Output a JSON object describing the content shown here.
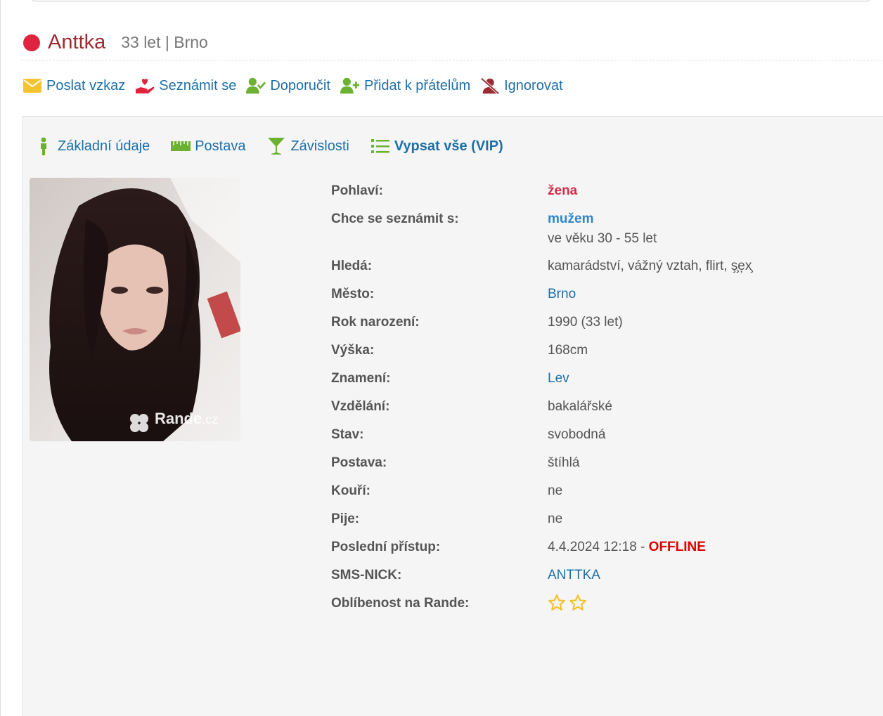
{
  "profile": {
    "nick": "Anttka",
    "age_city": "33 let | Brno"
  },
  "actions": [
    {
      "label": "Poslat vzkaz",
      "icon": "envelope-icon",
      "color": "#f4c430"
    },
    {
      "label": "Seznámit se",
      "icon": "hand-heart-icon",
      "color": "#e0233f"
    },
    {
      "label": "Doporučit",
      "icon": "user-check-icon",
      "color": "#6bb233"
    },
    {
      "label": "Přidat k přátelům",
      "icon": "user-plus-icon",
      "color": "#6bb233"
    },
    {
      "label": "Ignorovat",
      "icon": "user-slash-icon",
      "color": "#9b2d32"
    }
  ],
  "tabs": [
    {
      "label": "Základní údaje",
      "icon": "person-icon"
    },
    {
      "label": "Postava",
      "icon": "ruler-icon"
    },
    {
      "label": "Závislosti",
      "icon": "cocktail-glass-icon"
    },
    {
      "label": "Vypsat vše (VIP)",
      "icon": "list-icon"
    }
  ],
  "photo": {
    "watermark": "Rande",
    "watermark_suffix": ".cz"
  },
  "details": {
    "gender": {
      "label": "Pohlaví:",
      "value": "žena"
    },
    "wants": {
      "label": "Chce se seznámit s:",
      "value": "mužem",
      "age_range": "ve věku 30 - 55 let"
    },
    "seeks": {
      "label": "Hledá:",
      "value": "kamarádství, vážný vztah, flirt, ş̧e̦x̧"
    },
    "city": {
      "label": "Město:",
      "value": "Brno"
    },
    "birth_year": {
      "label": "Rok narození:",
      "value": "1990 (33 let)"
    },
    "height": {
      "label": "Výška:",
      "value": "168cm"
    },
    "zodiac": {
      "label": "Znamení:",
      "value": "Lev"
    },
    "education": {
      "label": "Vzdělání:",
      "value": "bakalářské"
    },
    "status": {
      "label": "Stav:",
      "value": "svobodná"
    },
    "figure": {
      "label": "Postava:",
      "value": "štíhlá"
    },
    "smokes": {
      "label": "Kouří:",
      "value": "ne"
    },
    "drinks": {
      "label": "Pije:",
      "value": "ne"
    },
    "last_access": {
      "label": "Poslední přístup:",
      "value": "4.4.2024 12:18 - ",
      "state": "OFFLINE"
    },
    "sms_nick": {
      "label": "SMS-NICK:",
      "value": "ANTTKA"
    },
    "popularity": {
      "label": "Oblíbenost na Rande:",
      "stars": 2,
      "star_color": "#f2c12e"
    }
  }
}
